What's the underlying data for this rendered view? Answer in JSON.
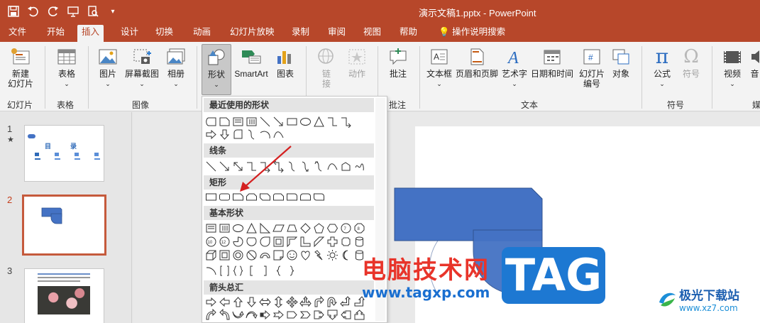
{
  "window": {
    "title": "演示文稿1.pptx  -  PowerPoint"
  },
  "qat": [
    {
      "name": "save-icon",
      "glyph": "💾"
    },
    {
      "name": "undo-icon",
      "glyph": "↶"
    },
    {
      "name": "redo-icon",
      "glyph": "↻"
    },
    {
      "name": "slideshow-icon",
      "glyph": "⧉"
    },
    {
      "name": "preview-icon",
      "glyph": "⌕"
    },
    {
      "name": "customize-icon",
      "glyph": "▾"
    }
  ],
  "tabs": [
    "文件",
    "开始",
    "插入",
    "设计",
    "切换",
    "动画",
    "幻灯片放映",
    "录制",
    "审阅",
    "视图",
    "帮助",
    "操作说明搜索"
  ],
  "active_tab": "插入",
  "ribbon": {
    "new_slide": "新建\n幻灯片",
    "table": "表格",
    "picture": "图片",
    "screenshot": "屏幕截图",
    "album": "相册",
    "shapes": "形状",
    "smartart": "SmartArt",
    "chart": "图表",
    "link": "链\n接",
    "action": "动作",
    "comment": "批注",
    "textbox": "文本框",
    "header_footer": "页眉和页脚",
    "wordart": "艺术字",
    "datetime": "日期和时间",
    "slide_number": "幻灯片\n编号",
    "object": "对象",
    "equation": "公式",
    "symbol": "符号",
    "video": "视频",
    "audio": "音",
    "groups": {
      "slides": "幻灯片",
      "tables": "表格",
      "images": "图像",
      "comments": "批注",
      "text": "文本",
      "symbols": "符号",
      "media": "媒"
    }
  },
  "shapes_menu": {
    "recent": "最近使用的形状",
    "lines": "线条",
    "rectangles": "矩形",
    "basic": "基本形状",
    "arrows": "箭头总汇"
  },
  "slides": [
    {
      "num": "1",
      "star": "★",
      "title": "目　　录"
    },
    {
      "num": "2"
    },
    {
      "num": "3"
    }
  ],
  "watermark": {
    "brand": "电脑技术网",
    "url": "www.tagxp.com",
    "tag": "TAG",
    "site_name": "极光下载站",
    "site_url": "www.xz7.com"
  },
  "colors": {
    "titlebar": "#b7472a",
    "shape_fill": "#4472c4"
  }
}
